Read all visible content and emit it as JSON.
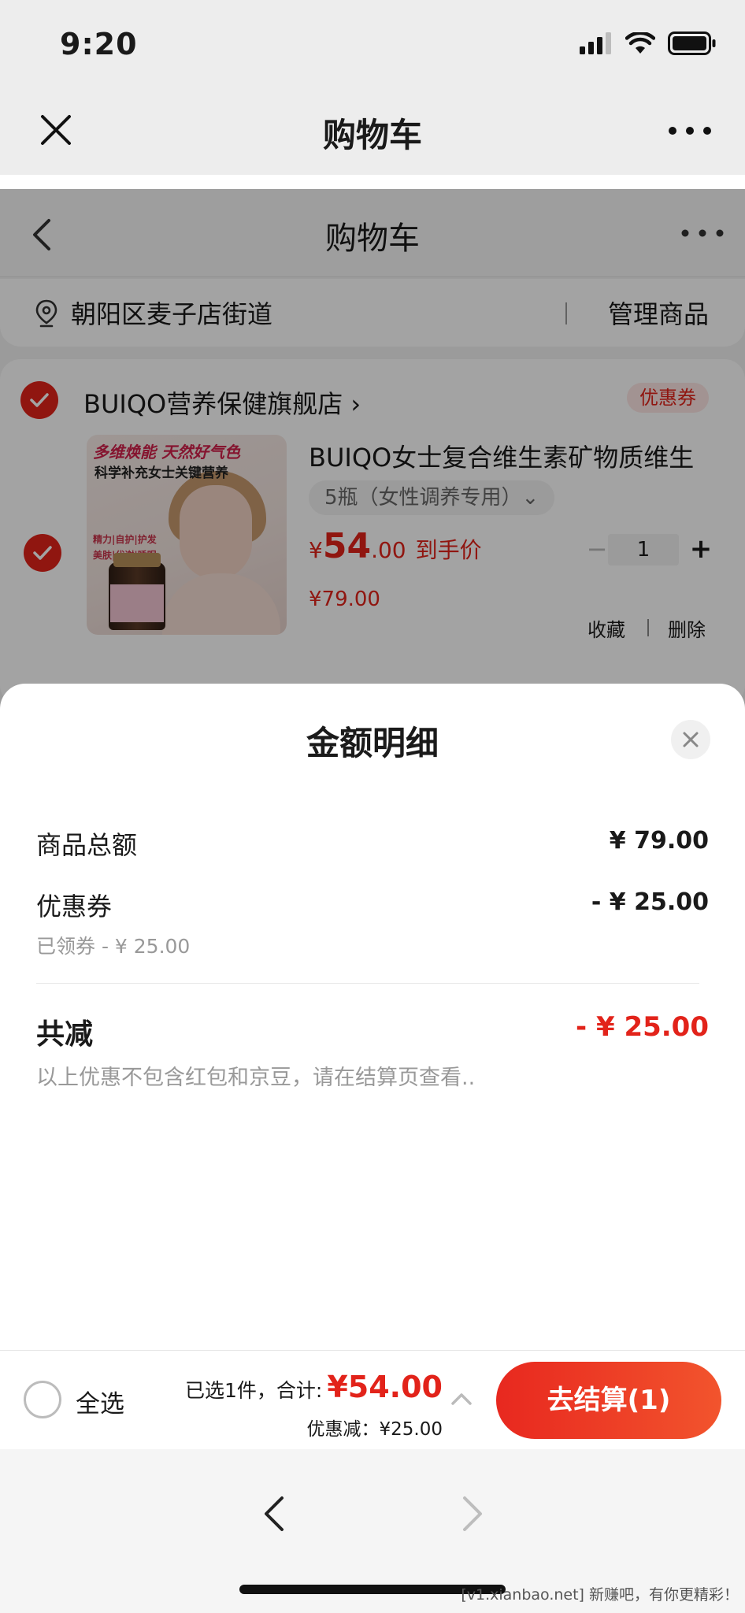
{
  "status_bar": {
    "time": "9:20"
  },
  "wechat_bar": {
    "title": "购物车"
  },
  "inner_page": {
    "title": "购物车",
    "address": "朝阳区麦子店街道",
    "manage": "管理商品",
    "shop": {
      "name": "BUIQO营养保健旗舰店 ›",
      "coupon_tag": "优惠券"
    },
    "product": {
      "image_text": [
        "多维焕能 天然好气色",
        "科学补充女士关键营养",
        "精力|自护|护发",
        "美肤|代谢|睡眠"
      ],
      "title": "BUIQO女士复合维生素矿物质维生",
      "sku": "5瓶（女性调养专用）⌄",
      "price_symbol": "¥",
      "price_int": "54",
      "price_dec": ".00",
      "price_label": "到手价",
      "original_price": "¥79.00",
      "quantity": "1",
      "minus": "−",
      "plus": "+",
      "favorite": "收藏",
      "delete": "删除"
    }
  },
  "sheet": {
    "title": "金额明细",
    "rows": [
      {
        "label": "商品总额",
        "value": "¥ 79.00"
      },
      {
        "label": "优惠券",
        "value": "- ¥ 25.00",
        "sub": "已领券 - ¥ 25.00"
      }
    ],
    "total_label": "共减",
    "total_value": "- ¥ 25.00",
    "note": "以上优惠不包含红包和京豆，请在结算页查看.."
  },
  "checkout": {
    "select_all": "全选",
    "summary": "已选1件，合计:",
    "amount": "¥54.00",
    "discount": "优惠减：¥25.00",
    "pay_button": "去结算(1)"
  },
  "watermark": "[v1.xianbao.net] 新赚吧，有你更精彩！",
  "colors": {
    "accent": "#e2231a",
    "sheet_bg": "#ffffff",
    "overlay": "rgba(0,0,0,0.36)"
  }
}
